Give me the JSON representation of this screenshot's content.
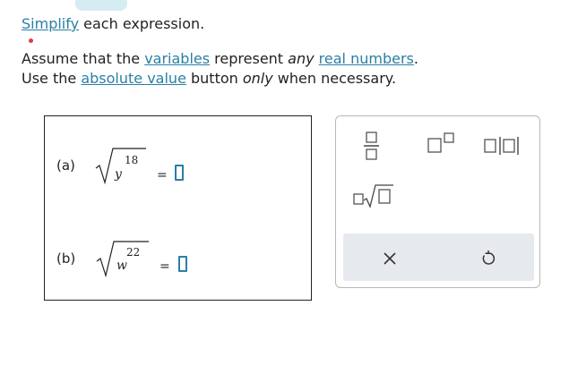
{
  "instructions": {
    "simplify_link": "Simplify",
    "line1_rest": " each expression.",
    "line2_pre": "Assume that the ",
    "variables_link": "variables",
    "line2_mid": " represent ",
    "any": "any",
    "real_numbers_link": "real numbers",
    "line2_end": ".",
    "line3_pre": "Use the ",
    "absolute_value_link": "absolute value",
    "line3_mid": " button ",
    "only": "only",
    "line3_end": " when necessary."
  },
  "problems": [
    {
      "label": "(a)",
      "variable": "y",
      "exponent": "18",
      "equals": "="
    },
    {
      "label": "(b)",
      "variable": "w",
      "exponent": "22",
      "equals": "="
    }
  ],
  "palette": {
    "buttons": [
      "fraction-icon",
      "superscript-icon",
      "absolute-value-icon",
      "nth-root-icon"
    ],
    "actions": [
      "clear-icon",
      "undo-icon"
    ]
  },
  "colors": {
    "accent": "#2a7fa6",
    "tab": "#d6ecf3",
    "action_bar": "#e6e9ee",
    "required_dot": "#e23b3b"
  }
}
